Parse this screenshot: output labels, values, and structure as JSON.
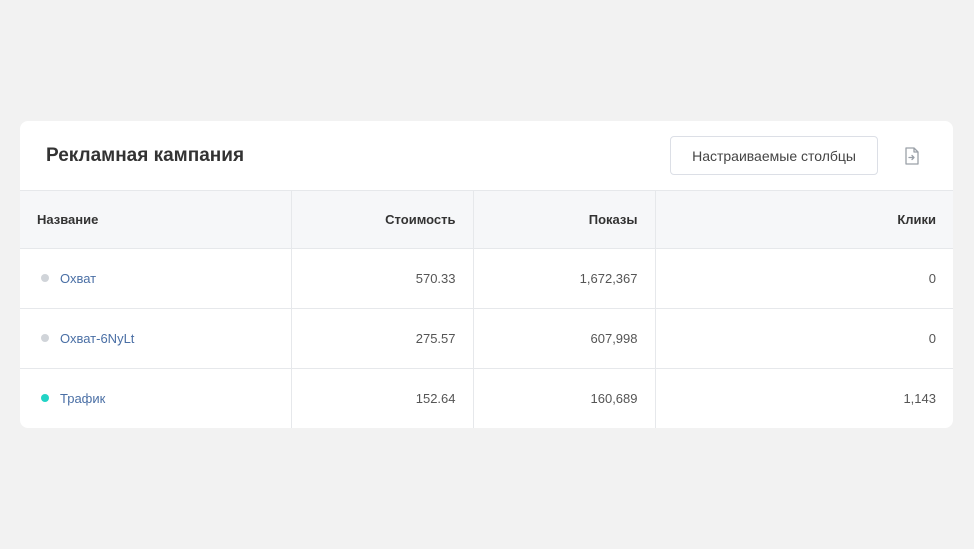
{
  "card": {
    "title": "Рекламная кампания",
    "columns_button_label": "Настраиваемые столбцы",
    "export_icon": "file-export-icon"
  },
  "table": {
    "headers": {
      "name": "Название",
      "cost": "Стоимость",
      "impressions": "Показы",
      "clicks": "Клики"
    },
    "rows": [
      {
        "name": "Охват",
        "cost": "570.33",
        "impressions": "1,672,367",
        "clicks": "0",
        "status_color": "#d0d4d9"
      },
      {
        "name": "Охват-6NyLt",
        "cost": "275.57",
        "impressions": "607,998",
        "clicks": "0",
        "status_color": "#d0d4d9"
      },
      {
        "name": "Трафик",
        "cost": "152.64",
        "impressions": "160,689",
        "clicks": "1,143",
        "status_color": "#22d3c5"
      }
    ]
  }
}
